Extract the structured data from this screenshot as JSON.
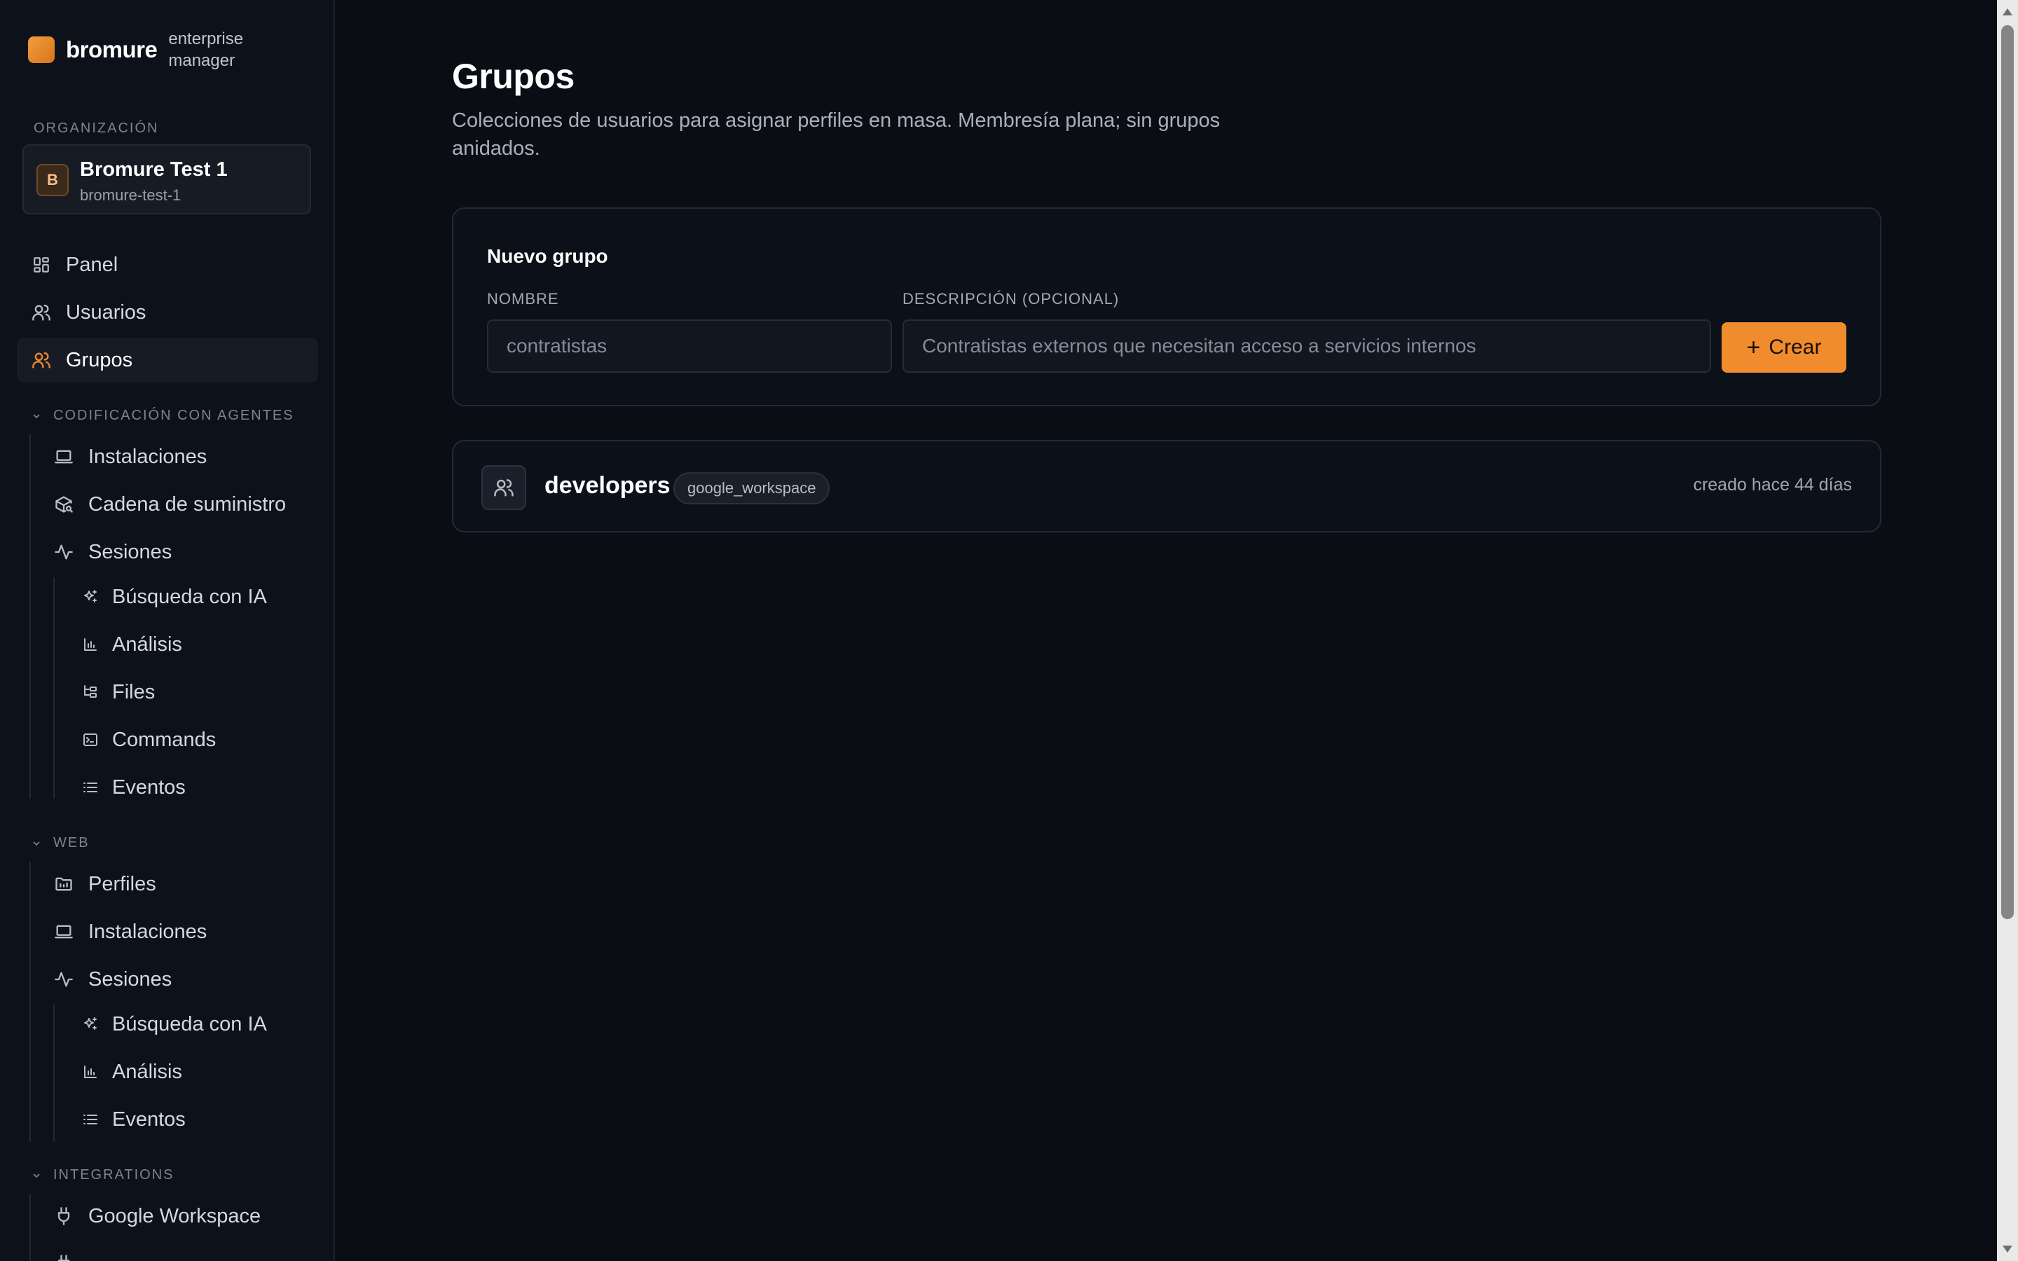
{
  "brand": {
    "name": "bromure",
    "subtitle": "enterprise manager"
  },
  "organization": {
    "section_label": "ORGANIZACIÓN",
    "avatar_letter": "B",
    "name": "Bromure Test 1",
    "slug": "bromure-test-1"
  },
  "nav": {
    "panel": "Panel",
    "usuarios": "Usuarios",
    "grupos": "Grupos"
  },
  "agents_section": {
    "title": "CODIFICACIÓN CON AGENTES",
    "instalaciones": "Instalaciones",
    "cadena": "Cadena de suministro",
    "sesiones": "Sesiones",
    "busqueda": "Búsqueda con IA",
    "analisis": "Análisis",
    "files": "Files",
    "commands": "Commands",
    "eventos": "Eventos"
  },
  "web_section": {
    "title": "WEB",
    "perfiles": "Perfiles",
    "instalaciones": "Instalaciones",
    "sesiones": "Sesiones",
    "busqueda": "Búsqueda con IA",
    "analisis": "Análisis",
    "eventos": "Eventos"
  },
  "integrations_section": {
    "title": "INTEGRATIONS",
    "google": "Google Workspace"
  },
  "page": {
    "title": "Grupos",
    "description": "Colecciones de usuarios para asignar perfiles en masa. Membresía plana; sin grupos anidados."
  },
  "new_group": {
    "title": "Nuevo grupo",
    "name_label": "NOMBRE",
    "name_placeholder": "contratistas",
    "desc_label": "DESCRIPCIÓN (OPCIONAL)",
    "desc_placeholder": "Contratistas externos que necesitan acceso a servicios internos",
    "create_label": "Crear"
  },
  "groups": [
    {
      "name": "developers",
      "source": "google_workspace",
      "created": "creado hace 44 días"
    }
  ],
  "colors": {
    "accent": "#f08c2e",
    "background": "#0a0d14",
    "sidebar": "#0d1119"
  }
}
